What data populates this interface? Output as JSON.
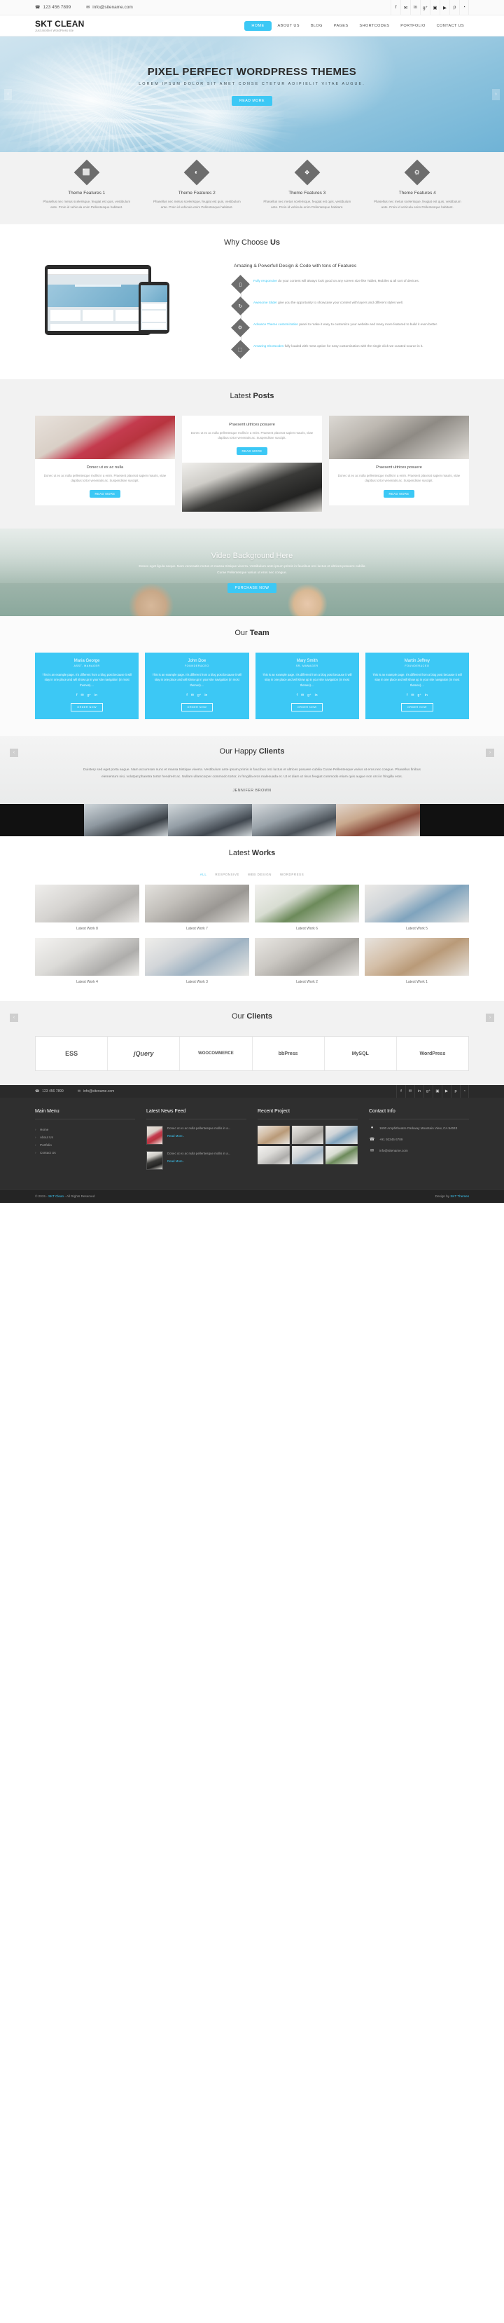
{
  "topbar": {
    "phone": "123 456 7899",
    "email": "info@sitename.com",
    "phone_icon": "phone-icon",
    "email_icon": "envelope-icon",
    "social": [
      {
        "name": "facebook",
        "glyph": "f"
      },
      {
        "name": "twitter",
        "glyph": "✉"
      },
      {
        "name": "linkedin",
        "glyph": "in"
      },
      {
        "name": "google-plus",
        "glyph": "g⁺"
      },
      {
        "name": "flickr",
        "glyph": "▣"
      },
      {
        "name": "youtube",
        "glyph": "▶"
      },
      {
        "name": "pinterest",
        "glyph": "p"
      },
      {
        "name": "rss",
        "glyph": "◔"
      }
    ]
  },
  "header": {
    "logo": "SKT CLEAN",
    "tagline": "Just another WordPress site",
    "nav": [
      {
        "label": "HOME",
        "active": true
      },
      {
        "label": "ABOUT US",
        "active": false
      },
      {
        "label": "BLOG",
        "active": false
      },
      {
        "label": "PAGES",
        "active": false
      },
      {
        "label": "SHORTCODES",
        "active": false
      },
      {
        "label": "PORTFOLIO",
        "active": false
      },
      {
        "label": "CONTACT US",
        "active": false
      }
    ]
  },
  "hero": {
    "title": "PIXEL PERFECT WORDPRESS THEMES",
    "subtitle": "LOREM IPSUM DOLOR SIT AMET CONSE CTETUR ADIPIELIT VITAE AUGUE.",
    "button": "READ MORE",
    "prev": "‹",
    "next": "›"
  },
  "features": {
    "items": [
      {
        "icon": "monitor-icon",
        "glyph": "⬜",
        "title": "Theme Features 1",
        "text": "Phasellus nec metus scelerisque, feugiat est quis, vestibulum ante. Proin id vehicula enim Pellentesque habitant."
      },
      {
        "icon": "eye-icon",
        "glyph": "◐",
        "title": "Theme Features 2",
        "text": "Phasellus nec metus scelerisque, feugiat est quis, vestibulum ante. Proin id vehicula enim Pellentesque habitant."
      },
      {
        "icon": "layers-icon",
        "glyph": "❖",
        "title": "Theme Features 3",
        "text": "Phasellus nec metus scelerisque, feugiat est quis, vestibulum ante. Proin id vehicula enim Pellentesque habitant."
      },
      {
        "icon": "gear-icon",
        "glyph": "⚙",
        "title": "Theme Features 4",
        "text": "Phasellus nec metus scelerisque, feugiat est quis, vestibulum ante. Proin id vehicula enim Pellentesque habitant."
      }
    ]
  },
  "why": {
    "title_light": "Why Choose ",
    "title_bold": "Us",
    "subtitle": "Amazing & Powerfull Design & Code with tons of Features",
    "items": [
      {
        "icon": "mobile-icon",
        "glyph": "▯",
        "highlight": "Fully responsive",
        "text": " do your content will always look good on any screen size like Tablet, Mobiles & all sort of devices."
      },
      {
        "icon": "refresh-icon",
        "glyph": "↻",
        "highlight": "Awesome Slider",
        "text": " give you the opportunity to showcase your content with layers and different styles well."
      },
      {
        "icon": "settings-icon",
        "glyph": "⚙",
        "highlight": "Advance Theme customization",
        "text": " panel to make it easy to customize your website and many more featured to build it even better."
      },
      {
        "icon": "shortcode-icon",
        "glyph": "⬚",
        "highlight": "Amazing Shortcodes",
        "text": " fully loaded with meta option for easy customization with the single click we curated source in it."
      }
    ]
  },
  "posts": {
    "title_light": "Latest ",
    "title_bold": "Posts",
    "read_more": "READ MORE",
    "left": {
      "image": "woman-laptop-photo",
      "title": "Donec ut ex ac nulla",
      "text": "Donec ut ex ac nulla pellentesque mollis in a enim. Praesent placerat sapien mauris, vitae dapibus tortor venenatis ac. Suspendisse suscipit."
    },
    "middle": {
      "title": "Praesent ultrices posuere",
      "text": "Donec ut ex ac nulla pellentesque mollis in a enim. Praesent placerat sapien mauris, vitae dapibus tortor venenatis ac. Suspendisse suscipit.",
      "image": "businessman-suit-photo"
    },
    "right": {
      "image": "alarm-clock-photo",
      "title": "Praesent ultrices posuere",
      "text": "Donec ut ex ac nulla pellentesque mollis in a enim. Praesent placerat sapien mauris, vitae dapibus tortor venenatis ac. Suspendisse suscipit."
    }
  },
  "video": {
    "title": "Video Background Here",
    "text": "Donec eget ligula neque. Nam venenatis metus et massa tristique viverra. Vestibulum ante ipsum primis in faucibus orci luctus et ultrices posuere cubilia Curae Pellentesque varius ut eros nec congue.",
    "button": "PURCHASE NOW"
  },
  "team": {
    "title_light": "Our ",
    "title_bold": "Team",
    "button": "ORDER NOW",
    "bio": "This is an example page. It's different from a blog post because it will stay in one place and will show up in your site navigation (in most themes)....",
    "social_glyphs": [
      "f",
      "✉",
      "g⁺",
      "in"
    ],
    "members": [
      {
        "name": "Maria George",
        "role": "ASST. MANAGER"
      },
      {
        "name": "John Doe",
        "role": "FOUNDER&CEO"
      },
      {
        "name": "Mary Smith",
        "role": "SR. MANAGER"
      },
      {
        "name": "Martin Jeffrey",
        "role": "FOUNDER&CEO"
      }
    ]
  },
  "happy": {
    "title_light": "Our Happy ",
    "title_bold": "Clients",
    "quote": "Duistery sed eget porta augue. Nam accumsan nunc et massa tristique viverra. Vestibulum ante ipsum primis in faucibus orci luctus et ultrices posuere cubilia Curae Pellentesque varius ut eros nec congue. Phasellus finibus elementum nisi, volutpat pharetra tortor hendrerit ac. Nullam ullamcorper commodo tortor, in fringilla eros malesuada et. Ut et diam ut risus feugiat commodo etiam quis augue non orci in fringilla eros.",
    "author": "JENNIFER BROWN",
    "prev": "‹",
    "next": "›"
  },
  "works": {
    "title_light": "Latest ",
    "title_bold": "Works",
    "filters": [
      {
        "label": "ALL",
        "active": true
      },
      {
        "label": "RESPONSIVE",
        "active": false
      },
      {
        "label": "WEB DESIGN",
        "active": false
      },
      {
        "label": "WORDPRESS",
        "active": false
      }
    ],
    "items": [
      {
        "caption": "Latest Work 8",
        "image": "desk-flatlay-photo"
      },
      {
        "caption": "Latest Work 7",
        "image": "phone-sketch-photo"
      },
      {
        "caption": "Latest Work 6",
        "image": "plant-desk-photo"
      },
      {
        "caption": "Latest Work 5",
        "image": "charts-laptop-photo"
      },
      {
        "caption": "Latest Work 4",
        "image": "laptop-white-photo"
      },
      {
        "caption": "Latest Work 3",
        "image": "papers-desk-photo"
      },
      {
        "caption": "Latest Work 2",
        "image": "mouse-photo"
      },
      {
        "caption": "Latest Work 1",
        "image": "hands-keyboard-photo"
      }
    ]
  },
  "clients": {
    "title_light": "Our ",
    "title_bold": "Clients",
    "prev": "‹",
    "next": "›",
    "logos": [
      "ESS",
      "jQuery",
      "WOOCOMMERCE",
      "bbPress",
      "MySQL",
      "WordPress"
    ]
  },
  "footer": {
    "bar": {
      "phone": "123 456 7899",
      "email": "info@sitename.com",
      "social": [
        {
          "name": "facebook",
          "glyph": "f"
        },
        {
          "name": "twitter",
          "glyph": "✉"
        },
        {
          "name": "linkedin",
          "glyph": "in"
        },
        {
          "name": "google-plus",
          "glyph": "g⁺"
        },
        {
          "name": "flickr",
          "glyph": "▣"
        },
        {
          "name": "youtube",
          "glyph": "▶"
        },
        {
          "name": "pinterest",
          "glyph": "p"
        },
        {
          "name": "rss",
          "glyph": "◔"
        }
      ]
    },
    "main_menu": {
      "title": "Main Menu",
      "items": [
        "Home",
        "About Us",
        "Portfolio",
        "Contact Us"
      ]
    },
    "news": {
      "title": "Latest News Feed",
      "read_more": "Read More..",
      "items": [
        {
          "text": "Donec ut ex ac nulla pellentesque mollis in a...",
          "image": "woman-laptop-photo"
        },
        {
          "text": "Donec ut ex ac nulla pellentesque mollis in a...",
          "image": "businessman-suit-photo"
        }
      ]
    },
    "recent": {
      "title": "Recent Project",
      "count": 6
    },
    "contact": {
      "title": "Contact Info",
      "address": "1600 Amphitheatre Parkway Mountain View, CA 94043",
      "phone": "+91 92345 6789",
      "email": "info@sitename.com",
      "address_icon": "map-pin-icon",
      "phone_icon": "phone-icon",
      "email_icon": "envelope-icon"
    },
    "copyright_pre": "© 2015 - ",
    "copyright_link": "SKT Clean",
    "copyright_post": " - All Rights Reserved",
    "design_pre": "Design by ",
    "design_link": "SKT Themes"
  }
}
